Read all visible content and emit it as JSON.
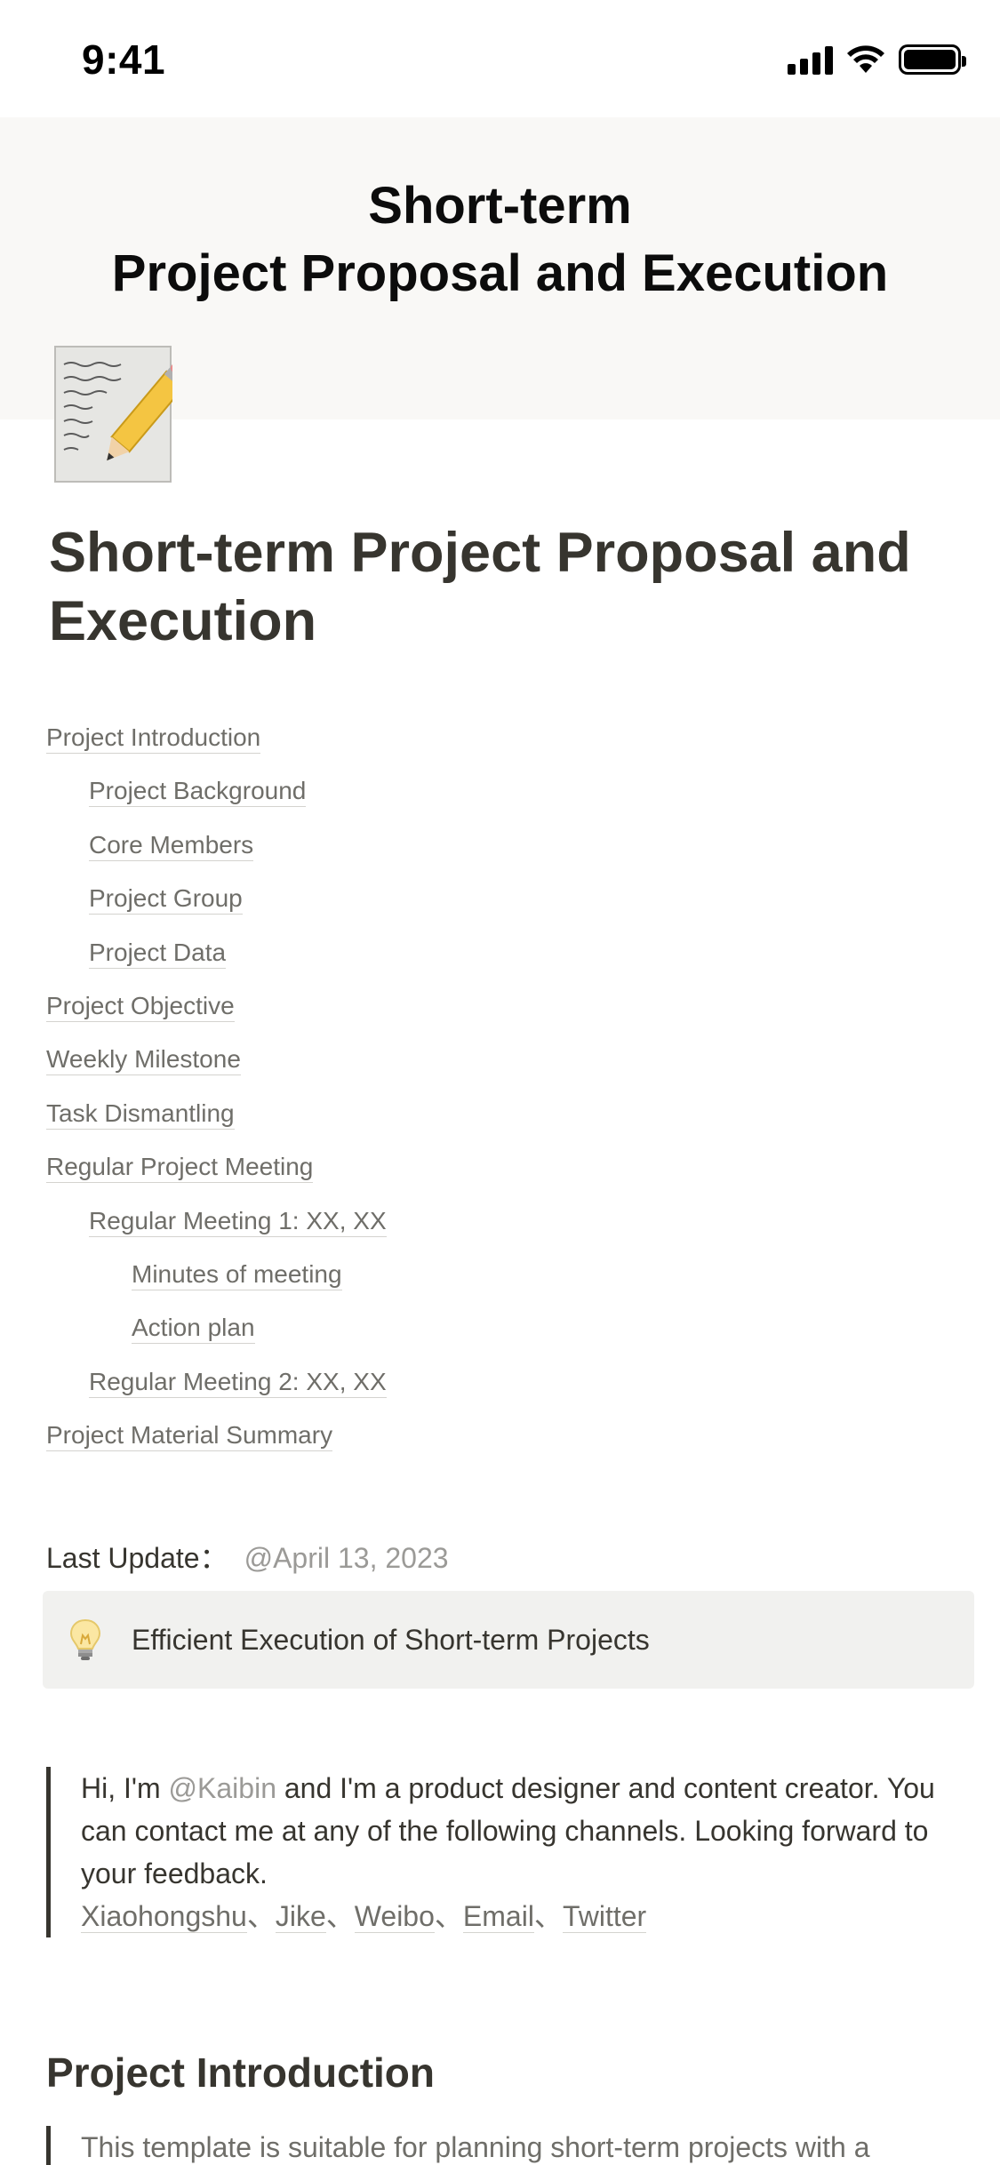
{
  "status_bar": {
    "time": "9:41"
  },
  "cover": {
    "title_line1": "Short-term",
    "title_line2": "Project Proposal and Execution"
  },
  "page": {
    "icon": "memo-pencil-icon",
    "title": "Short-term Project Proposal and Execution"
  },
  "toc": [
    {
      "label": "Project Introduction",
      "level": 1
    },
    {
      "label": "Project Background",
      "level": 2
    },
    {
      "label": "Core Members",
      "level": 2
    },
    {
      "label": "Project Group",
      "level": 2
    },
    {
      "label": "Project Data",
      "level": 2
    },
    {
      "label": "Project Objective",
      "level": 1
    },
    {
      "label": "Weekly Milestone",
      "level": 1
    },
    {
      "label": "Task Dismantling",
      "level": 1
    },
    {
      "label": "Regular Project Meeting",
      "level": 1
    },
    {
      "label": "Regular Meeting 1: XX, XX",
      "level": 2
    },
    {
      "label": "Minutes of meeting",
      "level": 3
    },
    {
      "label": "Action plan",
      "level": 3
    },
    {
      "label": "Regular Meeting 2: XX, XX",
      "level": 2
    },
    {
      "label": "Project Material Summary",
      "level": 1
    }
  ],
  "last_update": {
    "label": "Last Update：",
    "date": "@April 13, 2023"
  },
  "callout": {
    "icon": "light-bulb-icon",
    "text": "Efficient Execution of Short-term Projects"
  },
  "intro_quote": {
    "prefix": "Hi, I'm ",
    "mention": "@Kaibin",
    "rest": " and I'm a product designer and content creator. You can contact me at any of the following channels. Looking forward to your feedback.",
    "channels": [
      "Xiaohongshu",
      "Jike",
      "Weibo",
      "Email",
      "Twitter"
    ],
    "separator": "、"
  },
  "section": {
    "heading": "Project Introduction",
    "quote_start": "This template is suitable for planning short-term projects with a"
  }
}
